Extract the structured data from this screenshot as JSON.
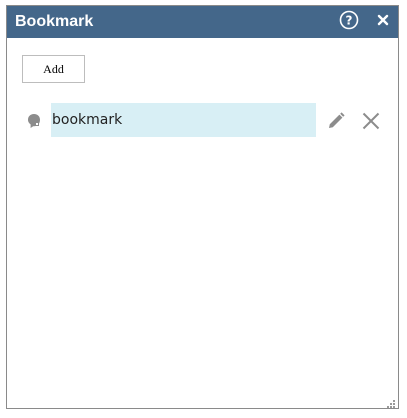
{
  "window": {
    "title": "Bookmark",
    "help_icon": "help-circle-icon",
    "close_icon": "close-icon"
  },
  "toolbar": {
    "add_label": "Add"
  },
  "bookmarks": [
    {
      "name": "bookmark",
      "icon": "bookmark-icon",
      "edit_icon": "pencil-icon",
      "delete_icon": "x-icon"
    }
  ],
  "colors": {
    "titlebar": "#44678a",
    "title_text": "#ffffff",
    "selected_row": "#d8eff5",
    "icon_gray": "#8c8c8c"
  }
}
